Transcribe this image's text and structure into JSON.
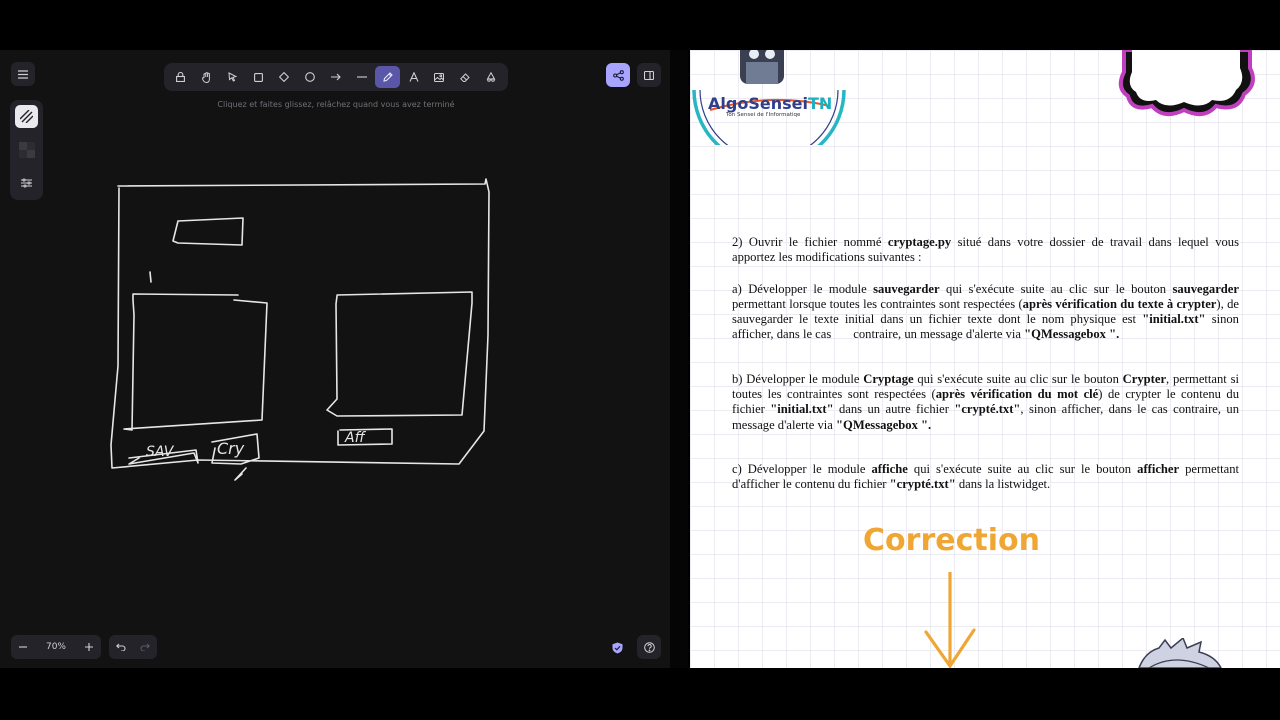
{
  "canvas": {
    "hint": "Cliquez et faites glissez, relâchez quand vous avez terminé",
    "zoom": "70%",
    "toolbar": {
      "tools": [
        "lock",
        "hand",
        "selection",
        "rectangle",
        "diamond",
        "ellipse",
        "arrow",
        "line",
        "draw",
        "text",
        "image",
        "eraser",
        "extra-tools"
      ],
      "active_tool": "draw"
    },
    "sketch_labels": [
      "SAV",
      "Cry",
      "Aff"
    ],
    "colors": {
      "background": "#121212",
      "accent": "#a8a5ff",
      "stroke": "#e6e6e6"
    }
  },
  "document": {
    "logo": {
      "name": "AlgoSensei",
      "suffix": "TN",
      "tagline": "Ton Sensei de l'Informatiqe"
    },
    "q2": {
      "t1": "2) Ouvrir le fichier nommé ",
      "b1": "cryptage.py",
      "t2": " situé dans votre dossier de travail dans lequel vous apportez les modifications suivantes :"
    },
    "qa": {
      "t1": "a) Développer le module ",
      "b1": "sauvegarder",
      "t2": " qui s'exécute suite au clic sur le bouton ",
      "b2": "sauvegarder",
      "t3": " permettant lorsque toutes les contraintes sont respectées (",
      "b3": "après vérification du texte à crypter",
      "t4": "), de sauvegarder le texte initial dans un fichier texte dont le nom physique est ",
      "b4": "\"initial.txt\"",
      "t5": " sinon afficher, dans le cas       contraire, un message d'alerte via ",
      "b5": "\"QMessagebox \"."
    },
    "qb": {
      "t1": "b) Développer le module ",
      "b1": "Cryptage",
      "t2": " qui s'exécute suite au clic sur le bouton ",
      "b2": "Crypter",
      "t3": ", permettant si toutes les contraintes sont respectées (",
      "b3": "après vérification du mot clé",
      "t4": ") de crypter le contenu du fichier ",
      "b4": "\"initial.txt\"",
      "t5": " dans un autre fichier ",
      "b5": "\"crypté.txt\"",
      "t6": ", sinon afficher, dans le cas contraire, un message d'alerte via ",
      "b6": "\"QMessagebox \"."
    },
    "qc": {
      "t1": "c) Développer le module ",
      "b1": "affiche",
      "t2": " qui s'exécute suite au clic sur le bouton ",
      "b2": "afficher",
      "t3": " permettant d'afficher le contenu du fichier ",
      "b3": "\"crypté.txt\"",
      "t4": " dans la listwidget."
    },
    "correction": "Correction",
    "colors": {
      "correction": "#f0a632",
      "logo_blue": "#2f3e8d",
      "logo_teal": "#1eaec3",
      "cloud": "#c03fbf"
    }
  }
}
